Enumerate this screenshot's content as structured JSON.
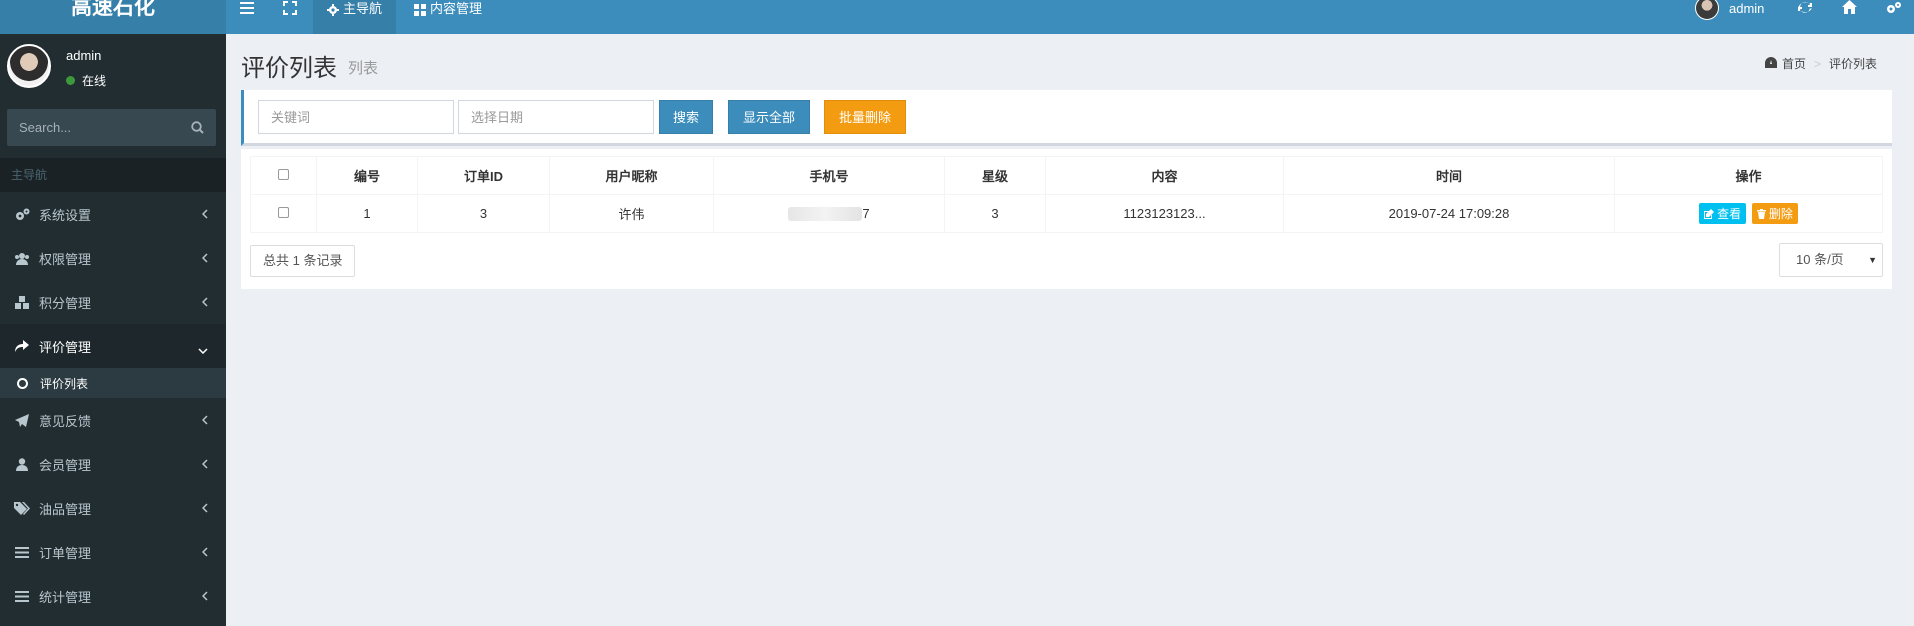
{
  "app": {
    "logo": "高速石化"
  },
  "topbar": {
    "tabs": [
      {
        "label": "主导航",
        "icon": "gear-icon",
        "active": true
      },
      {
        "label": "内容管理",
        "icon": "grid-icon",
        "active": false
      }
    ],
    "user_name": "admin"
  },
  "sidebar": {
    "user_name": "admin",
    "status": "在线",
    "search_placeholder": "Search...",
    "nav_header": "主导航",
    "items": [
      {
        "label": "系统设置",
        "icon": "cogs-icon"
      },
      {
        "label": "权限管理",
        "icon": "users-icon"
      },
      {
        "label": "积分管理",
        "icon": "cubes-icon"
      },
      {
        "label": "评价管理",
        "icon": "share-icon",
        "active": true
      },
      {
        "label": "意见反馈",
        "icon": "send-icon"
      },
      {
        "label": "会员管理",
        "icon": "user-icon"
      },
      {
        "label": "油品管理",
        "icon": "tags-icon"
      },
      {
        "label": "订单管理",
        "icon": "list-icon"
      },
      {
        "label": "统计管理",
        "icon": "list-icon"
      }
    ],
    "submenu_label": "评价列表"
  },
  "page": {
    "title": "评价列表",
    "subtitle": "列表",
    "breadcrumb": {
      "home": "首页",
      "current": "评价列表"
    }
  },
  "filters": {
    "keyword_placeholder": "关键词",
    "date_placeholder": "选择日期",
    "search_label": "搜索",
    "show_all_label": "显示全部",
    "batch_delete_label": "批量删除"
  },
  "table": {
    "columns": [
      "编号",
      "订单ID",
      "用户昵称",
      "手机号",
      "星级",
      "内容",
      "时间",
      "操作"
    ],
    "rows": [
      {
        "id": "1",
        "order_id": "3",
        "nickname": "许伟",
        "phone_tail": "7",
        "stars": "3",
        "content": "1123123123...",
        "time": "2019-07-24 17:09:28",
        "view_label": "查看",
        "delete_label": "删除"
      }
    ]
  },
  "footer": {
    "total": "总共 1 条记录",
    "page_size": "10 条/页"
  },
  "colors": {
    "topbar": "#3c8dbc",
    "sidebar": "#222d32",
    "primary": "#3c8dbc",
    "warning": "#f39c12",
    "info": "#00c0ef"
  }
}
